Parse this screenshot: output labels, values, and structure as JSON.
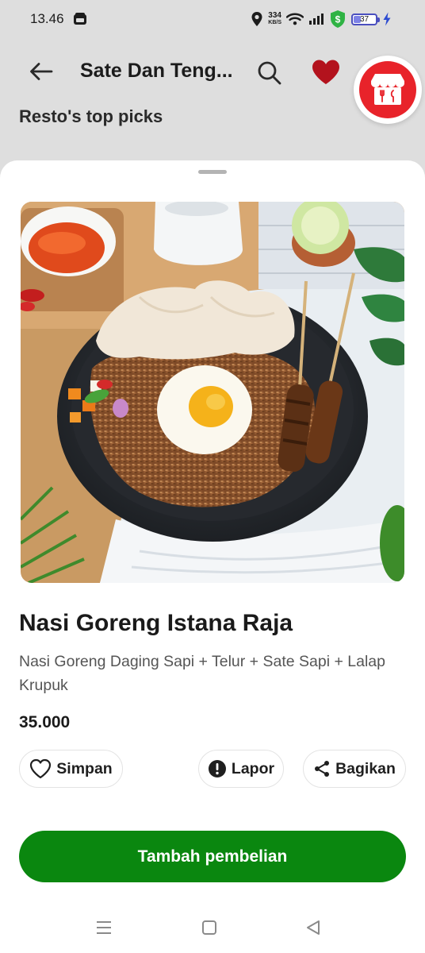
{
  "status_bar": {
    "time": "13.46",
    "net_speed_value": "334",
    "net_speed_unit": "KB/S",
    "battery_percent": 37,
    "battery_label": "37"
  },
  "header": {
    "title": "Sate Dan Teng...",
    "section_title": "Resto's top picks"
  },
  "product": {
    "name": "Nasi Goreng Istana Raja",
    "description": "Nasi Goreng Daging Sapi + Telur + Sate Sapi + Lalap Krupuk",
    "price": "35.000",
    "image_icon": "fried-rice-dish-photo"
  },
  "actions": {
    "save_label": "Simpan",
    "report_label": "Lapor",
    "share_label": "Bagikan",
    "add_to_cart_label": "Tambah pembelian"
  },
  "icons": {
    "back": "arrow-left-icon",
    "search": "search-icon",
    "favorite": "heart-icon",
    "store": "store-icon",
    "save": "heart-outline-icon",
    "report": "alert-icon",
    "share": "share-icon",
    "nav_menu": "menu-icon",
    "nav_home": "square-icon",
    "nav_back": "triangle-back-icon"
  },
  "colors": {
    "primary_green": "#0a870f",
    "favorite_red": "#b3121d",
    "store_red": "#e8232a",
    "dim_background": "#dedede"
  }
}
